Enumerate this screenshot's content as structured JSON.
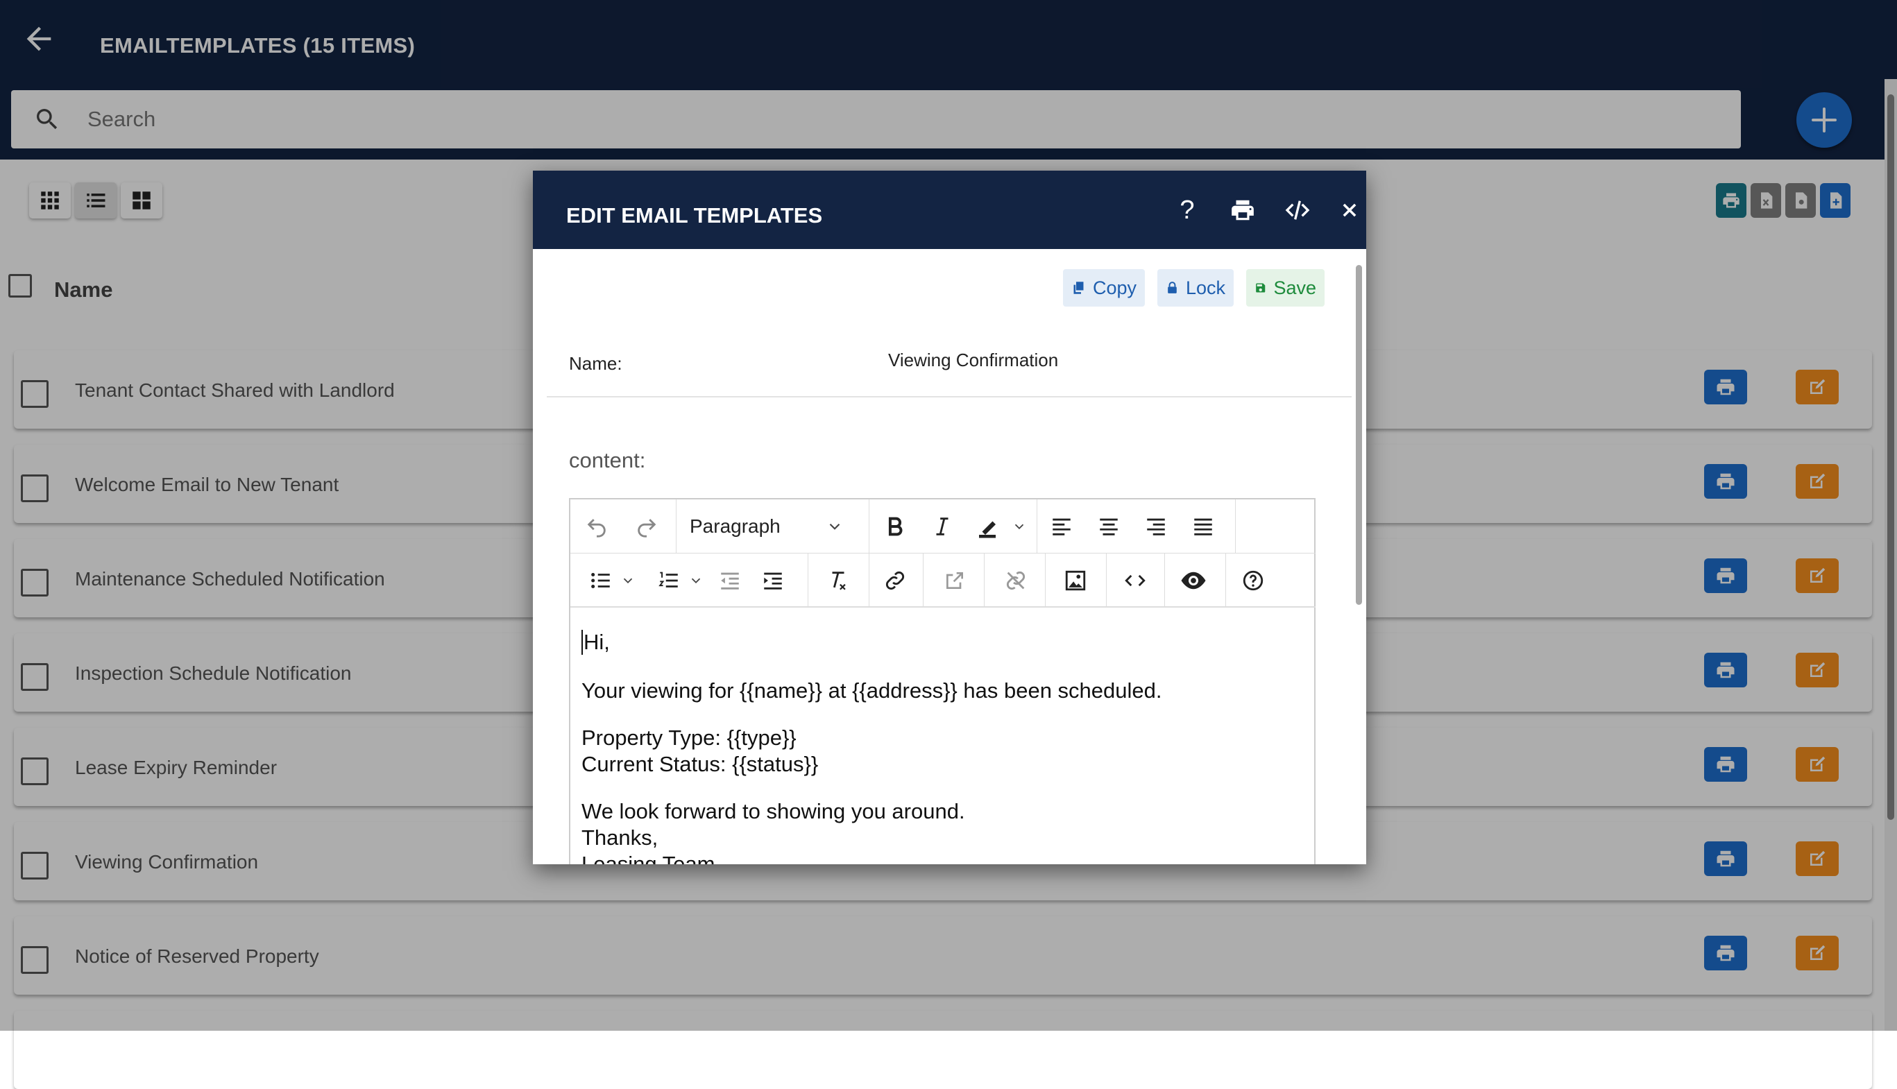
{
  "header": {
    "title": "EMAILTEMPLATES (15 ITEMS)"
  },
  "search": {
    "placeholder": "Search"
  },
  "list": {
    "column_header": "Name",
    "rows": [
      {
        "label": "Tenant Contact Shared with Landlord"
      },
      {
        "label": "Welcome Email to New Tenant"
      },
      {
        "label": "Maintenance Scheduled Notification"
      },
      {
        "label": "Inspection Schedule Notification"
      },
      {
        "label": "Lease Expiry Reminder"
      },
      {
        "label": "Viewing Confirmation"
      },
      {
        "label": "Notice of Reserved Property"
      }
    ]
  },
  "icons": {
    "back": "arrow-left-icon",
    "search": "search-icon",
    "add": "plus-icon",
    "row_print": "print-icon",
    "row_edit": "edit-icon"
  },
  "export_buttons": [
    "print",
    "excel",
    "pdf",
    "word"
  ],
  "colors": {
    "header_bg": "#132443",
    "primary": "#1e6fcf",
    "accent_orange": "#f7901e",
    "export_teal": "#1a7b8c",
    "export_gray": "#808080",
    "save_green": "#1e8b3c"
  },
  "modal": {
    "title": "EDIT EMAIL TEMPLATES",
    "help_glyph": "?",
    "actions": {
      "copy": "Copy",
      "lock": "Lock",
      "save": "Save"
    },
    "name_label": "Name:",
    "name_value": "Viewing Confirmation",
    "content_label": "content:",
    "editor": {
      "block_format": "Paragraph",
      "doc_lines": [
        "Hi,",
        "Your viewing for {{name}} at {{address}} has been scheduled.",
        "Property Type: {{type}}",
        "Current Status: {{status}}",
        "We look forward to showing you around.",
        "Thanks,",
        "Leasing Team"
      ]
    }
  }
}
